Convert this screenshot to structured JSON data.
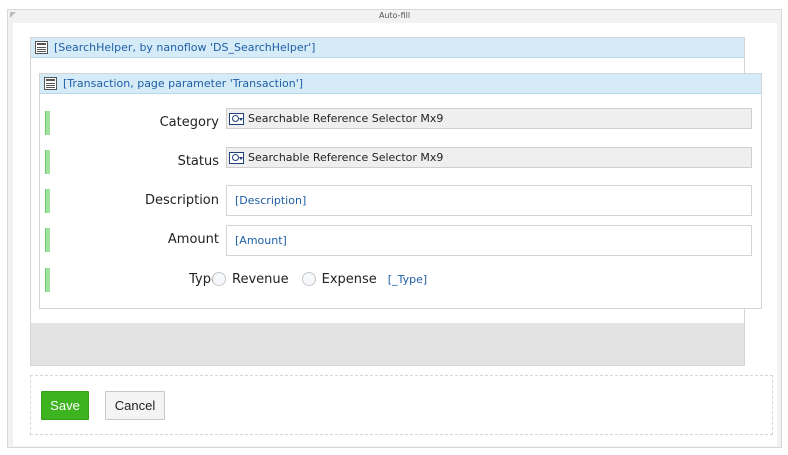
{
  "popup": {
    "title": "Auto-fill"
  },
  "outer_dataview": {
    "header_label": "[SearchHelper, by nanoflow 'DS_SearchHelper']",
    "icon": "dataview-icon"
  },
  "inner_dataview": {
    "header_label": "[Transaction, page parameter 'Transaction']",
    "icon": "dataview-icon"
  },
  "fields": {
    "category": {
      "label": "Category",
      "widget": "Searchable Reference Selector Mx9",
      "icon": "reference-selector-icon"
    },
    "status": {
      "label": "Status",
      "widget": "Searchable Reference Selector Mx9",
      "icon": "reference-selector-icon"
    },
    "description": {
      "label": "Description",
      "value": "[Description]"
    },
    "amount": {
      "label": "Amount",
      "value": "[Amount]"
    },
    "type": {
      "label": "Type",
      "options": [
        "Revenue",
        "Expense"
      ],
      "attribute": "[_Type]"
    }
  },
  "buttons": {
    "save": "Save",
    "cancel": "Cancel"
  },
  "colors": {
    "header_bg": "#d6ebf8",
    "link_blue": "#1f5fa6",
    "save_green": "#3cb31f",
    "field_marker": "#9ee29e"
  }
}
